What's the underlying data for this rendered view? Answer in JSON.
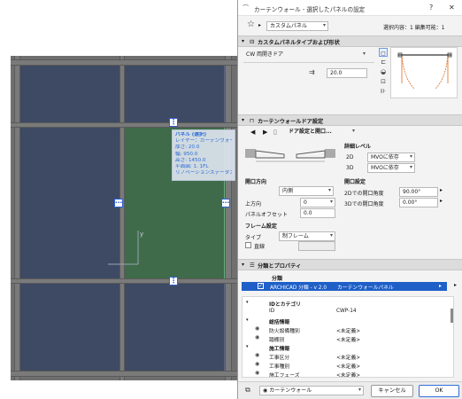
{
  "viewport": {
    "tooltip": {
      "title": "パネル (選択)",
      "lines": [
        "レイヤー：カーテンウォール",
        "厚さ: 20.0",
        "幅: 950.0",
        "高さ: 1450.0",
        "平面図: 1. 1FL",
        "リノベーションステータス: 既存"
      ]
    },
    "axis_label": "y"
  },
  "dialog": {
    "title": "カーテンウォール - 選択したパネルの設定",
    "help": "?",
    "close": "✕",
    "favorite_preset": "カスタムパネル",
    "selection_info": "選択内容：1 編集可能：1",
    "section_panel_type": "カスタムパネルタイプおよび形状",
    "panel_type_value": "CW 両開きドア",
    "thickness_value": "20.0",
    "section_door": "カーテンウォールドア設定",
    "door_breadcrumb": "ドア設定と開口...",
    "detail_level": "詳細レベル",
    "label_2d": "2D",
    "value_2d": "MVOに依存",
    "label_3d": "3D",
    "value_3d": "MVOに依存",
    "opening_direction": "開口方向",
    "direction_value": "内側",
    "label_up": "上方向",
    "up_value": "0",
    "label_panel_offset": "パネルオフセット",
    "panel_offset_value": "0.0",
    "opening_settings": "開口設定",
    "label_2d_angle": "2Dでの開口角度",
    "angle_2d_value": "90.00°",
    "label_3d_angle": "3Dでの開口角度",
    "angle_3d_value": "0.00°",
    "frame_settings": "フレーム設定",
    "label_type": "タイプ",
    "type_value": "制フレーム",
    "label_straight": "直線",
    "section_classification": "分類とプロパティ",
    "classification_header": "分類",
    "classification_value": "ARCHICAD 分類 - v 2.0",
    "classification_item": "カーテンウォールパネル",
    "properties": [
      {
        "name": "IDとカテゴリ",
        "value": "",
        "kind": "group"
      },
      {
        "name": "ID",
        "value": "CWP-14",
        "kind": "item"
      },
      {
        "name": "総括情報",
        "value": "",
        "kind": "group"
      },
      {
        "name": "防火設備種別",
        "value": "<未定義>",
        "kind": "item"
      },
      {
        "name": "踏棚別",
        "value": "<未定義>",
        "kind": "item"
      },
      {
        "name": "施工情報",
        "value": "",
        "kind": "group"
      },
      {
        "name": "工事区分",
        "value": "<未定義>",
        "kind": "item"
      },
      {
        "name": "工事種別",
        "value": "<未定義>",
        "kind": "item"
      },
      {
        "name": "施工フェーズ",
        "value": "<未定義>",
        "kind": "item"
      }
    ],
    "layer_value": "カーテンウォール",
    "cancel_label": "キャンセル",
    "ok_label": "OK",
    "colors": {
      "selected_panel": "#3f6b4a",
      "panel": "#3e4a63",
      "frame": "#7a7a7a",
      "accent": "#2f6fd8",
      "highlight_row": "#1f5fc8"
    }
  }
}
